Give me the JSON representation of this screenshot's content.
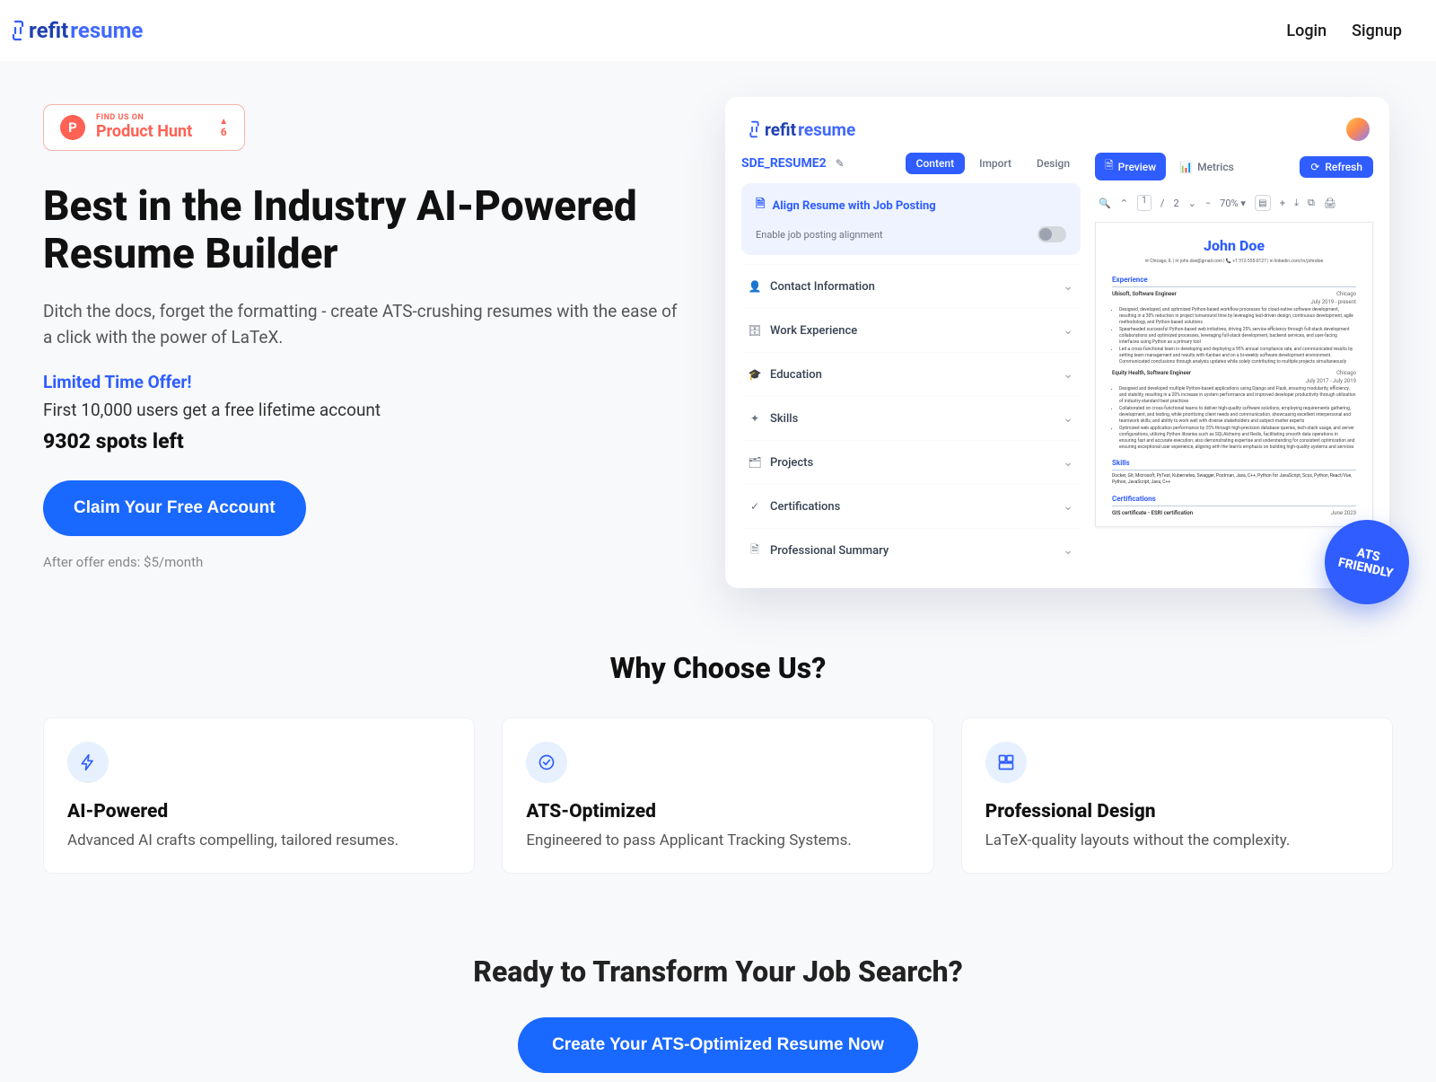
{
  "brand": {
    "refit": "refit",
    "resume": "resume"
  },
  "nav": {
    "login": "Login",
    "signup": "Signup"
  },
  "productHunt": {
    "findUs": "FIND US ON",
    "name": "Product Hunt",
    "votes": "6"
  },
  "hero": {
    "title": "Best in the Industry AI-Powered Resume Builder",
    "subtitle": "Ditch the docs, forget the formatting - create ATS-crushing resumes with the ease of a click with the power of LaTeX.",
    "limited": "Limited Time Offer!",
    "offerDetail": "First 10,000 users get a free lifetime account",
    "spotsLeft": "9302 spots left",
    "cta": "Claim Your Free Account",
    "afterOffer": "After offer ends: $5/month"
  },
  "appPreview": {
    "docName": "SDE_RESUME2",
    "tabs": {
      "content": "Content",
      "import": "Import",
      "design": "Design"
    },
    "alignTitle": "Align Resume with Job Posting",
    "alignToggle": "Enable job posting alignment",
    "sections": [
      "Contact Information",
      "Work Experience",
      "Education",
      "Skills",
      "Projects",
      "Certifications",
      "Professional Summary"
    ],
    "previewTabs": {
      "preview": "Preview",
      "metrics": "Metrics"
    },
    "refresh": "Refresh",
    "pdfToolbar": {
      "currentPage": "1",
      "totalPages": "2",
      "zoom": "70% ▾"
    },
    "resume": {
      "name": "John Doe",
      "contact": "✉ Chicago, IL  |  ✉ john.doe@gmail.com  |  📞 +1 312-555-0127  |  in linkedin.com/in/johndoe",
      "exp": "Experience",
      "job1": {
        "title": "Ubisoft, Software Engineer",
        "loc": "Chicago",
        "date": "July 2019 - present"
      },
      "job2": {
        "title": "Equity Health, Software Engineer",
        "loc": "Chicago",
        "date": "July 2017 - July 2019"
      },
      "skills": "Skills",
      "skillsLine": "Docker, Git, Microsoft, PyTest, Kubernetes, Swagger, Postman, Java, C++, Python for JavaScript, Scss, Python, React/Vue, Python, JavaScript, Java, C++",
      "certs": "Certifications",
      "cert1": {
        "name": "GIS certificate - ESRI certification",
        "date": "June 2023"
      }
    },
    "atsBadge": {
      "l1": "ATS",
      "l2": "FRIENDLY"
    }
  },
  "why": {
    "title": "Why Choose Us?",
    "features": [
      {
        "title": "AI-Powered",
        "desc": "Advanced AI crafts compelling, tailored resumes."
      },
      {
        "title": "ATS-Optimized",
        "desc": "Engineered to pass Applicant Tracking Systems."
      },
      {
        "title": "Professional Design",
        "desc": "LaTeX-quality layouts without the complexity."
      }
    ]
  },
  "bottomCta": {
    "title": "Ready to Transform Your Job Search?",
    "button": "Create Your ATS-Optimized Resume Now"
  }
}
